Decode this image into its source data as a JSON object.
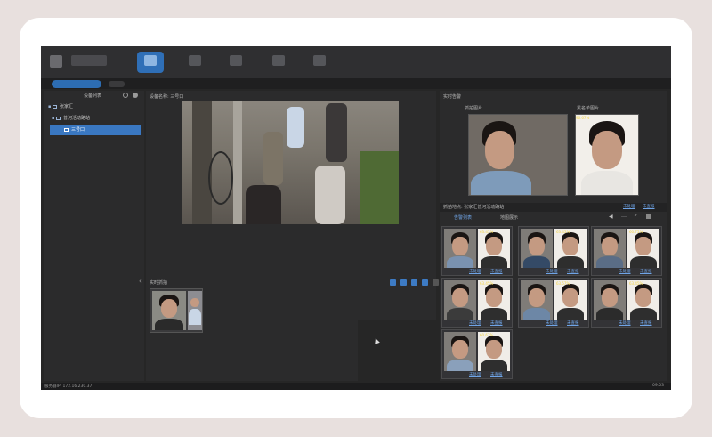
{
  "left_panel": {
    "title": "设备列表",
    "tree": [
      {
        "label": "张家汇",
        "level": 0
      },
      {
        "label": "普河活动路站",
        "level": 1
      },
      {
        "label": "三号口",
        "level": 2,
        "selected": true
      }
    ]
  },
  "center_panel": {
    "device_name": "设备名称: 三号口",
    "snapshot_title": "实时抓拍"
  },
  "right_panel": {
    "alarm_title": "实时告警",
    "capture_label": "抓拍图片",
    "blacklist_label": "黑名单图片",
    "main_score": "96.67%",
    "compare_title": "抓拍地点: 张家汇普河活动路站",
    "filter_unprocessed": "未处理",
    "filter_ignored": "未查报",
    "tab_list": "告警列表",
    "tab_map": "地图展示",
    "matches": [
      {
        "score": "63.45%",
        "a": "未处理",
        "b": "未查报"
      },
      {
        "score": "63.45%",
        "a": "未处理",
        "b": "未查报"
      },
      {
        "score": "60.75%",
        "a": "未处理",
        "b": "未查报"
      },
      {
        "score": "63.45%",
        "a": "未处理",
        "b": "未查报"
      },
      {
        "score": "63.57%",
        "a": "未处理",
        "b": "未查报"
      },
      {
        "score": "63.45%",
        "a": "未处理",
        "b": "未查报"
      },
      {
        "score": "60.67%",
        "a": "未处理",
        "b": "未查报"
      }
    ]
  },
  "status": {
    "server": "服务器IP: 172.16.230.37",
    "time": "09:03"
  },
  "colors": {
    "accent": "#2f6fb7",
    "score": "#f3d54a",
    "link": "#6fa4e6"
  }
}
